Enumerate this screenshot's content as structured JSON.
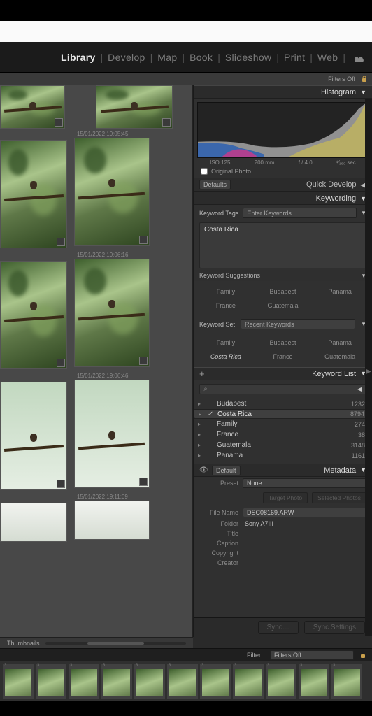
{
  "tabs": [
    "Library",
    "Develop",
    "Map",
    "Book",
    "Slideshow",
    "Print",
    "Web"
  ],
  "activeTab": "Library",
  "filtersBar": "Filters Off",
  "thumbs": [
    {
      "ts": ""
    },
    {
      "ts": ""
    },
    {
      "ts": "15/01/2022 19:05:45"
    },
    {
      "ts": "15/01/2022 19:06:16"
    },
    {
      "ts": "15/01/2022 19:06:46"
    },
    {
      "ts": "15/01/2022 19:11:09"
    }
  ],
  "hist": {
    "title": "Histogram",
    "meta": [
      "ISO 125",
      "200 mm",
      "f / 4.0",
      "¹⁄₁₆₀ sec"
    ],
    "orig": "Original Photo"
  },
  "qd": {
    "title": "Quick Develop",
    "preset": "Defaults"
  },
  "keywording": {
    "title": "Keywording",
    "tagsLabel": "Keyword Tags",
    "enter": "Enter Keywords",
    "tags": "Costa Rica",
    "sugTitle": "Keyword Suggestions",
    "sug": [
      "Family",
      "Budapest",
      "Panama",
      "France",
      "Guatemala",
      ""
    ],
    "setLabel": "Keyword Set",
    "setSel": "Recent Keywords",
    "set": [
      "Family",
      "Budapest",
      "Panama",
      "Costa Rica",
      "France",
      "Guatemala"
    ]
  },
  "klist": {
    "title": "Keyword List",
    "items": [
      {
        "n": "Budapest",
        "c": "1232"
      },
      {
        "n": "Costa Rica",
        "c": "8794",
        "checked": true
      },
      {
        "n": "Family",
        "c": "274"
      },
      {
        "n": "France",
        "c": "38"
      },
      {
        "n": "Guatemala",
        "c": "3148"
      },
      {
        "n": "Panama",
        "c": "1161"
      }
    ]
  },
  "meta": {
    "title": "Metadata",
    "preset": "Default",
    "presetLbl": "Preset",
    "none": "None",
    "btns": [
      "Target Photo",
      "Selected Photos"
    ],
    "fields": [
      {
        "l": "File Name",
        "v": "DSC08169.ARW",
        "box": true
      },
      {
        "l": "Folder",
        "v": "Sony A7III"
      },
      {
        "l": "Title",
        "v": ""
      },
      {
        "l": "Caption",
        "v": ""
      },
      {
        "l": "Copyright",
        "v": ""
      },
      {
        "l": "Creator",
        "v": ""
      }
    ]
  },
  "sync": [
    "Sync…",
    "Sync Settings"
  ],
  "thumbLabel": "Thumbnails",
  "filterRow": {
    "l": "Filter :",
    "v": "Filters Off"
  }
}
